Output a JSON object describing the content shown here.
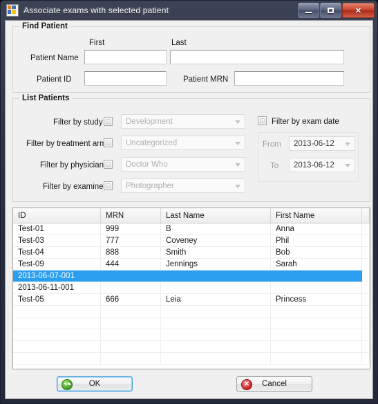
{
  "window": {
    "title": "Associate exams with selected patient",
    "icon": "application-icon",
    "controls": {
      "minimize": "minimize-button",
      "maximize": "maximize-button",
      "close_label": "✕"
    }
  },
  "find_patient": {
    "legend": "Find Patient",
    "first_label": "First",
    "last_label": "Last",
    "patient_name_label": "Patient Name",
    "patient_id_label": "Patient ID",
    "patient_mrn_label": "Patient MRN",
    "first_value": "",
    "last_value": "",
    "patient_id_value": "",
    "patient_mrn_value": ""
  },
  "list_patients": {
    "legend": "List Patients",
    "filters": [
      {
        "label": "Filter by study",
        "checked": false,
        "value": "Development"
      },
      {
        "label": "Filter by treatment arm",
        "checked": false,
        "value": "Uncategorized"
      },
      {
        "label": "Filter by physician",
        "checked": false,
        "value": "Doctor Who"
      },
      {
        "label": "Filter by examiner",
        "checked": false,
        "value": "Photographer"
      }
    ],
    "exam_date": {
      "label": "Filter by exam date",
      "checked": false,
      "from_label": "From",
      "to_label": "To",
      "from_value": "2013-06-12",
      "to_value": "2013-06-12"
    }
  },
  "grid": {
    "columns": [
      "ID",
      "MRN",
      "Last Name",
      "First Name",
      ""
    ],
    "rows": [
      {
        "cells": [
          "Test-01",
          "999",
          "B",
          "Anna",
          ""
        ],
        "selected": false
      },
      {
        "cells": [
          "Test-03",
          "777",
          "Coveney",
          "Phil",
          ""
        ],
        "selected": false
      },
      {
        "cells": [
          "Test-04",
          "888",
          "Smith",
          "Bob",
          ""
        ],
        "selected": false
      },
      {
        "cells": [
          "Test-09",
          "444",
          "Jennings",
          "Sarah",
          ""
        ],
        "selected": false
      },
      {
        "cells": [
          "2013-06-07-001",
          "",
          "",
          "",
          ""
        ],
        "selected": true
      },
      {
        "cells": [
          "2013-06-11-001",
          "",
          "",
          "",
          ""
        ],
        "selected": false
      },
      {
        "cells": [
          "Test-05",
          "666",
          "Leia",
          "Princess",
          ""
        ],
        "selected": false
      },
      {
        "cells": [
          "",
          "",
          "",
          "",
          ""
        ],
        "selected": false
      },
      {
        "cells": [
          "",
          "",
          "",
          "",
          ""
        ],
        "selected": false
      },
      {
        "cells": [
          "",
          "",
          "",
          "",
          ""
        ],
        "selected": false
      },
      {
        "cells": [
          "",
          "",
          "",
          "",
          ""
        ],
        "selected": false
      },
      {
        "cells": [
          "",
          "",
          "",
          "",
          ""
        ],
        "selected": false
      }
    ],
    "selection_color": "#2a9ff0"
  },
  "footer": {
    "ok_label": "OK",
    "cancel_label": "Cancel",
    "cancel_icon_glyph": "✕"
  }
}
